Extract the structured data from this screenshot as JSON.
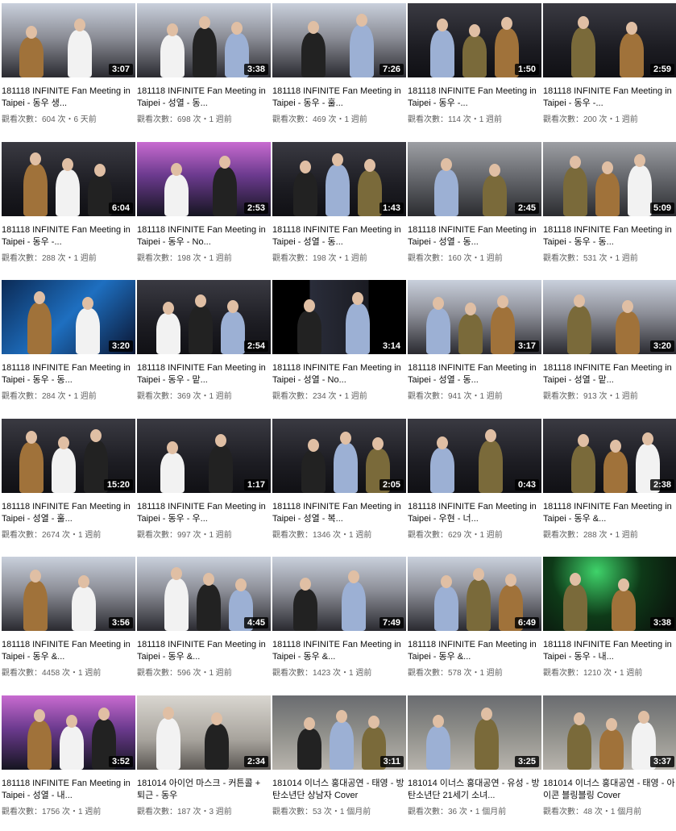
{
  "videos": [
    {
      "title": "181118 INFINITE Fan Meeting in Taipei - 동우 생...",
      "duration": "3:07",
      "meta": "觀看次數：604 次・6 天前",
      "scene": "stage"
    },
    {
      "title": "181118 INFINITE Fan Meeting in Taipei - 성열 - 동...",
      "duration": "3:38",
      "meta": "觀看次數：698 次・1 週前",
      "scene": "stage"
    },
    {
      "title": "181118 INFINITE Fan Meeting in Taipei - 동우 - 훌...",
      "duration": "7:26",
      "meta": "觀看次數：469 次・1 週前",
      "scene": "stage"
    },
    {
      "title": "181118 INFINITE Fan Meeting in Taipei - 동우 -...",
      "duration": "1:50",
      "meta": "觀看次數：114 次・1 週前",
      "scene": "dark"
    },
    {
      "title": "181118 INFINITE Fan Meeting in Taipei - 동우 -...",
      "duration": "2:59",
      "meta": "觀看次數：200 次・1 週前",
      "scene": "dark"
    },
    {
      "title": "181118 INFINITE Fan Meeting in Taipei - 동우 -...",
      "duration": "6:04",
      "meta": "觀看次數：288 次・1 週前",
      "scene": "dark"
    },
    {
      "title": "181118 INFINITE Fan Meeting in Taipei - 동우 - No...",
      "duration": "2:53",
      "meta": "觀看次數：198 次・1 週前",
      "scene": "pink"
    },
    {
      "title": "181118 INFINITE Fan Meeting in Taipei - 성열 - 동...",
      "duration": "1:43",
      "meta": "觀看次數：198 次・1 週前",
      "scene": "dark"
    },
    {
      "title": "181118 INFINITE Fan Meeting in Taipei - 성열 - 동...",
      "duration": "2:45",
      "meta": "觀看次數：160 次・1 週前",
      "scene": "grey"
    },
    {
      "title": "181118 INFINITE Fan Meeting in Taipei - 동우 - 동...",
      "duration": "5:09",
      "meta": "觀看次數：531 次・1 週前",
      "scene": "grey"
    },
    {
      "title": "181118 INFINITE Fan Meeting in Taipei - 동우 - 동...",
      "duration": "3:20",
      "meta": "觀看次數：284 次・1 週前",
      "scene": "blue"
    },
    {
      "title": "181118 INFINITE Fan Meeting in Taipei - 동우 - 맡...",
      "duration": "2:54",
      "meta": "觀看次數：369 次・1 週前",
      "scene": "dark"
    },
    {
      "title": "181118 INFINITE Fan Meeting in Taipei - 성열 - No...",
      "duration": "3:14",
      "meta": "觀看次數：234 次・1 週前",
      "scene": "black"
    },
    {
      "title": "181118 INFINITE Fan Meeting in Taipei - 성열 - 동...",
      "duration": "3:17",
      "meta": "觀看次數：941 次・1 週前",
      "scene": "stage"
    },
    {
      "title": "181118 INFINITE Fan Meeting in Taipei - 성열 - 맡...",
      "duration": "3:20",
      "meta": "觀看次數：913 次・1 週前",
      "scene": "stage"
    },
    {
      "title": "181118 INFINITE Fan Meeting in Taipei - 성열 - 훌...",
      "duration": "15:20",
      "meta": "觀看次數：2674 次・1 週前",
      "scene": "dark"
    },
    {
      "title": "181118 INFINITE Fan Meeting in Taipei - 동우 - 우...",
      "duration": "1:17",
      "meta": "觀看次數：997 次・1 週前",
      "scene": "dark"
    },
    {
      "title": "181118 INFINITE Fan Meeting in Taipei - 성열 - 복...",
      "duration": "2:05",
      "meta": "觀看次數：1346 次・1 週前",
      "scene": "dark"
    },
    {
      "title": "181118 INFINITE Fan Meeting in Taipei - 우현 - 너...",
      "duration": "0:43",
      "meta": "觀看次數：629 次・1 週前",
      "scene": "dark"
    },
    {
      "title": "181118 INFINITE Fan Meeting in Taipei - 동우 &...",
      "duration": "2:38",
      "meta": "觀看次數：288 次・1 週前",
      "scene": "dark"
    },
    {
      "title": "181118 INFINITE Fan Meeting in Taipei - 동우 &...",
      "duration": "3:56",
      "meta": "觀看次數：4458 次・1 週前",
      "scene": "stage"
    },
    {
      "title": "181118 INFINITE Fan Meeting in Taipei - 동우 &...",
      "duration": "4:45",
      "meta": "觀看次數：596 次・1 週前",
      "scene": "stage"
    },
    {
      "title": "181118 INFINITE Fan Meeting in Taipei - 동우 &...",
      "duration": "7:49",
      "meta": "觀看次數：1423 次・1 週前",
      "scene": "stage"
    },
    {
      "title": "181118 INFINITE Fan Meeting in Taipei - 동우 &...",
      "duration": "6:49",
      "meta": "觀看次數：578 次・1 週前",
      "scene": "stage"
    },
    {
      "title": "181118 INFINITE Fan Meeting in Taipei - 동우 - 내...",
      "duration": "3:38",
      "meta": "觀看次數：1210 次・1 週前",
      "scene": "green"
    },
    {
      "title": "181118 INFINITE Fan Meeting in Taipei - 성열 - 내...",
      "duration": "3:52",
      "meta": "觀看次數：1756 次・1 週前",
      "scene": "pink"
    },
    {
      "title": "181014 아이언 마스크 - 커튼콜 + 퇴근 - 동우",
      "duration": "2:34",
      "meta": "觀看次數：187 次・3 週前",
      "scene": "light"
    },
    {
      "title": "181014 이너스 홍대공연 - 태영 - 방탄소년단 상남자 Cover",
      "duration": "3:11",
      "meta": "觀看次數：53 次・1 個月前",
      "scene": "street"
    },
    {
      "title": "181014 이너스 홍대공연 - 유성 - 방탄소년단 21세기 소녀...",
      "duration": "3:25",
      "meta": "觀看次數：36 次・1 個月前",
      "scene": "street"
    },
    {
      "title": "181014 이너스 홍대공연 - 태영 - 아이콘 블링블링 Cover",
      "duration": "3:37",
      "meta": "觀看次數：48 次・1 個月前",
      "scene": "street"
    }
  ]
}
